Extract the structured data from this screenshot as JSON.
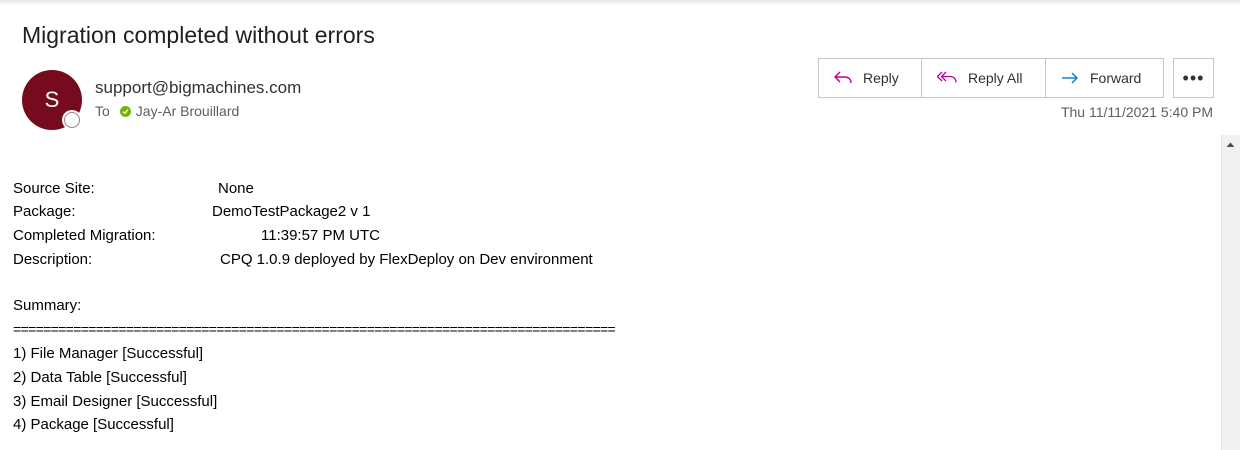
{
  "email": {
    "subject": "Migration completed without errors",
    "avatar_initial": "S",
    "sender": "support@bigmachines.com",
    "to_label": "To",
    "recipient": "Jay-Ar Brouillard",
    "date": "Thu 11/11/2021 5:40 PM"
  },
  "actions": {
    "reply": "Reply",
    "reply_all": "Reply All",
    "forward": "Forward",
    "more": "•••"
  },
  "body": {
    "fields": [
      {
        "label": "Source Site:",
        "value": "None"
      },
      {
        "label": "Package:",
        "value": "DemoTestPackage2 v 1"
      },
      {
        "label": "Completed Migration:",
        "value": "11:39:57 PM UTC"
      },
      {
        "label": "Description:",
        "value": "CPQ 1.0.9 deployed by FlexDeploy on Dev environment"
      }
    ],
    "summary_label": "Summary:",
    "separator": "================================================================================",
    "items": [
      "1) File Manager [Successful]",
      "2) Data Table [Successful]",
      "3) Email Designer [Successful]",
      "4) Package [Successful]"
    ]
  },
  "colors": {
    "avatar": "#750b1c",
    "presence_available": "#6bb700",
    "reply_icon": "#b4009e",
    "forward_icon": "#0078d4"
  }
}
